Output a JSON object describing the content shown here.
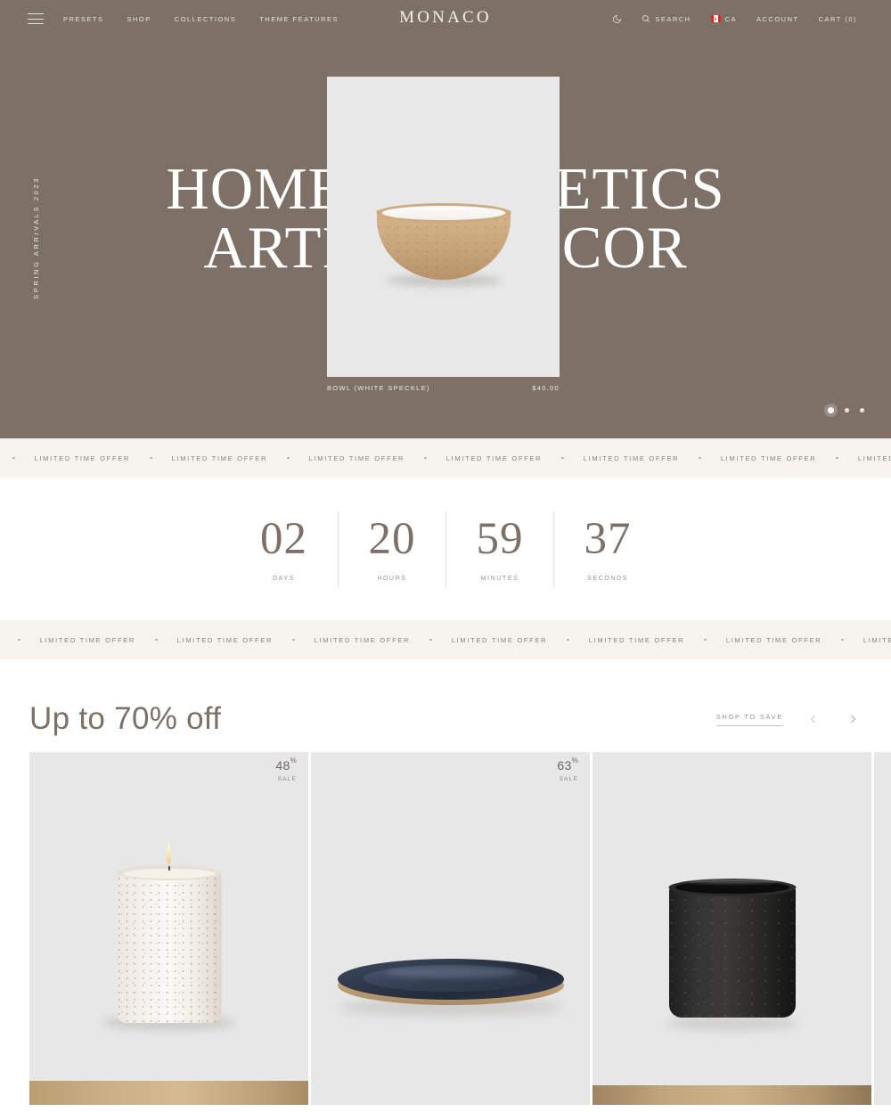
{
  "header": {
    "menu_icon": "hamburger-menu-icon",
    "logo": "MONACO",
    "nav_left": [
      {
        "label": "PRESETS"
      },
      {
        "label": "SHOP"
      },
      {
        "label": "COLLECTIONS"
      },
      {
        "label": "THEME FEATURES"
      }
    ],
    "theme_toggle_icon": "moon-icon",
    "search_icon": "search-icon",
    "search_label": "SEARCH",
    "locale_flag": "canada-flag-icon",
    "locale_label": "CA",
    "account_label": "ACCOUNT",
    "cart_label": "CART (0)"
  },
  "hero": {
    "vertical_label": "SPRING ARRIVALS 2023",
    "headline_line1": "HOME AESTHETICS",
    "headline_line2": "ARTISAN DECOR",
    "product_name": "BOWL (WHITE SPECKLE)",
    "product_price": "$40.00",
    "background_color": "#7d7067",
    "slides": [
      {
        "active": true
      },
      {
        "active": false
      },
      {
        "active": false
      }
    ]
  },
  "marquee": {
    "text": "LIMITED TIME OFFER",
    "background_color": "#f6f3ef"
  },
  "countdown": {
    "units": [
      {
        "value": "02",
        "label": "DAYS"
      },
      {
        "value": "20",
        "label": "HOURS"
      },
      {
        "value": "59",
        "label": "MINUTES"
      },
      {
        "value": "37",
        "label": "SECONDS"
      }
    ]
  },
  "sale": {
    "title": "Up to 70% off",
    "shop_link": "SHOP TO SAVE",
    "prev_icon": "chevron-left-icon",
    "next_icon": "chevron-right-icon",
    "products": [
      {
        "discount": "48",
        "percent_symbol": "%",
        "sale_label": "SALE",
        "image": "speckled-candle"
      },
      {
        "discount": "63",
        "percent_symbol": "%",
        "sale_label": "SALE",
        "image": "navy-plate"
      },
      {
        "discount": "",
        "percent_symbol": "",
        "sale_label": "",
        "image": "black-cup"
      }
    ]
  }
}
